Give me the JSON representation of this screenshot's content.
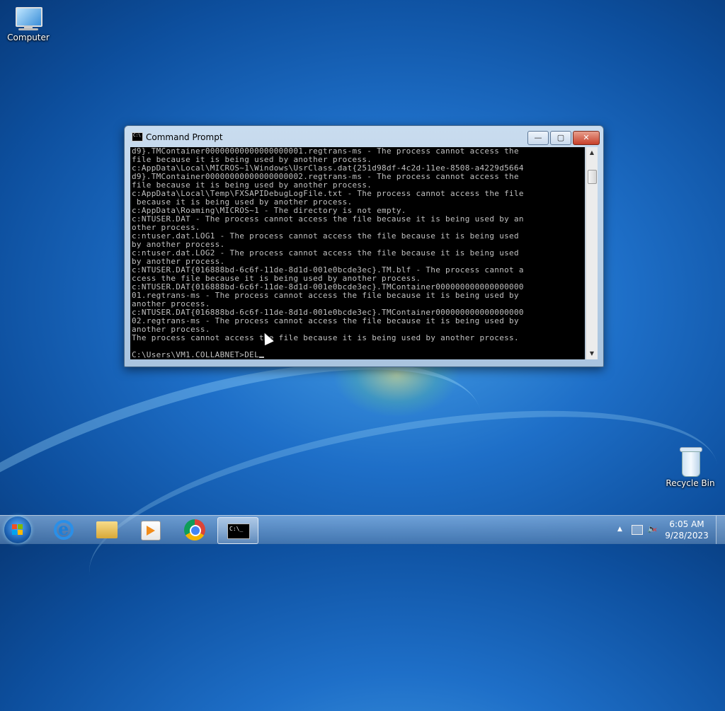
{
  "desktop": {
    "icons": [
      {
        "label": "Computer"
      },
      {
        "label": "Recycle Bin"
      }
    ]
  },
  "window": {
    "title": "Command Prompt",
    "controls": {
      "minimize": "—",
      "maximize": "▢",
      "close": "✕"
    },
    "console_lines": [
      "d9}.TMContainer00000000000000000001.regtrans-ms - The process cannot access the",
      "file because it is being used by another process.",
      "c:AppData\\Local\\MICROS~1\\Windows\\UsrClass.dat{251d98df-4c2d-11ee-8508-a4229d5664",
      "d9}.TMContainer00000000000000000002.regtrans-ms - The process cannot access the",
      "file because it is being used by another process.",
      "c:AppData\\Local\\Temp\\FXSAPIDebugLogFile.txt - The process cannot access the file",
      " because it is being used by another process.",
      "c:AppData\\Roaming\\MICROS~1 - The directory is not empty.",
      "c:NTUSER.DAT - The process cannot access the file because it is being used by an",
      "other process.",
      "c:ntuser.dat.LOG1 - The process cannot access the file because it is being used",
      "by another process.",
      "c:ntuser.dat.LOG2 - The process cannot access the file because it is being used",
      "by another process.",
      "c:NTUSER.DAT{016888bd-6c6f-11de-8d1d-001e0bcde3ec}.TM.blf - The process cannot a",
      "ccess the file because it is being used by another process.",
      "c:NTUSER.DAT{016888bd-6c6f-11de-8d1d-001e0bcde3ec}.TMContainer000000000000000000",
      "01.regtrans-ms - The process cannot access the file because it is being used by",
      "another process.",
      "c:NTUSER.DAT{016888bd-6c6f-11de-8d1d-001e0bcde3ec}.TMContainer000000000000000000",
      "02.regtrans-ms - The process cannot access the file because it is being used by",
      "another process.",
      "The process cannot access the file because it is being used by another process.",
      "",
      "C:\\Users\\VM1.COLLABNET>DEL"
    ]
  },
  "taskbar": {
    "clock_time": "6:05 AM",
    "clock_date": "9/28/2023",
    "tray_arrow": "▲"
  },
  "icons": {
    "start": "windows-flag-icon",
    "ie": "internet-explorer-icon",
    "explorer": "folder-icon",
    "media": "media-player-icon",
    "chrome": "chrome-icon",
    "cmd": "command-prompt-icon"
  }
}
